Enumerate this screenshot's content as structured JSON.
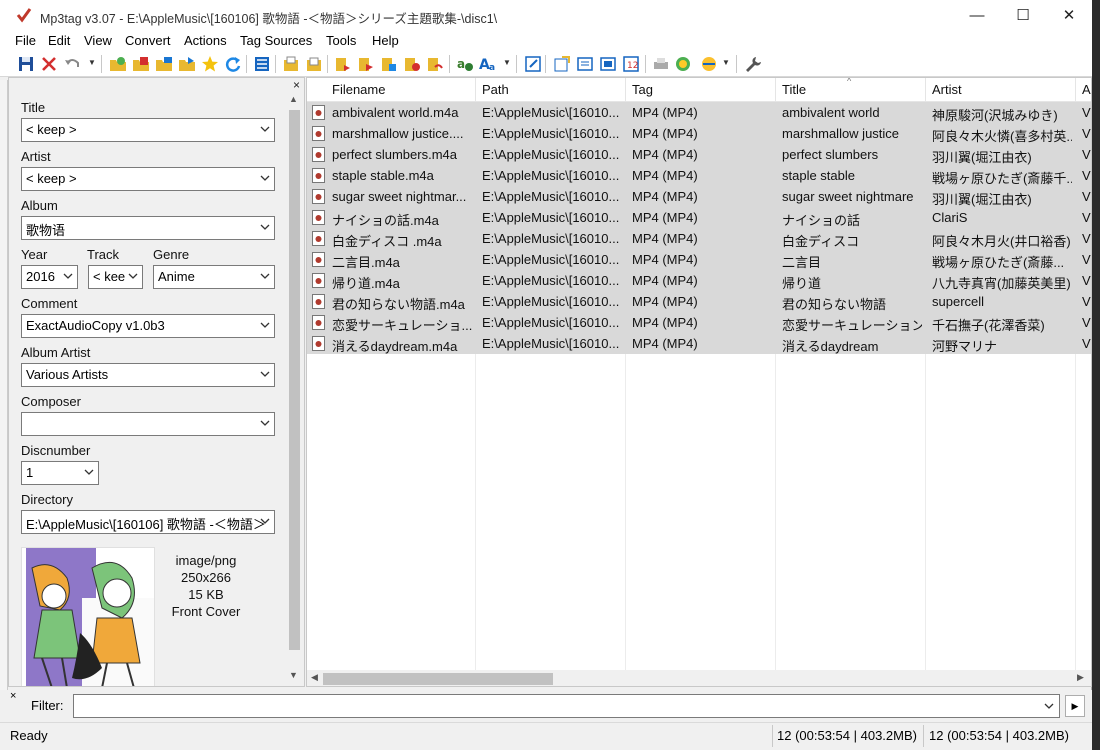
{
  "window": {
    "title": "Mp3tag v3.07  -  E:\\AppleMusic\\[160106] 歌物語 -＜物語＞シリーズ主題歌集-\\disc1\\",
    "minimize": "—",
    "maximize": "☐",
    "close": "✕"
  },
  "menu": [
    "File",
    "Edit",
    "View",
    "Convert",
    "Actions",
    "Tag Sources",
    "Tools",
    "Help"
  ],
  "tagpanel": {
    "close": "×",
    "title_label": "Title",
    "title_value": "< keep >",
    "artist_label": "Artist",
    "artist_value": "< keep >",
    "album_label": "Album",
    "album_value": "歌物语",
    "year_label": "Year",
    "year_value": "2016",
    "track_label": "Track",
    "track_value": "< kee",
    "genre_label": "Genre",
    "genre_value": "Anime",
    "comment_label": "Comment",
    "comment_value": "ExactAudioCopy v1.0b3",
    "albumartist_label": "Album Artist",
    "albumartist_value": "Various Artists",
    "composer_label": "Composer",
    "composer_value": "",
    "discnumber_label": "Discnumber",
    "discnumber_value": "1",
    "directory_label": "Directory",
    "directory_value": "E:\\AppleMusic\\[160106] 歌物語 -＜物語＞",
    "cover": {
      "mime": "image/png",
      "dimensions": "250x266",
      "size": "15 KB",
      "type": "Front Cover"
    }
  },
  "filelist": {
    "columns": [
      "Filename",
      "Path",
      "Tag",
      "Title",
      "Artist",
      "A"
    ],
    "rows": [
      {
        "filename": "ambivalent world.m4a",
        "path": "E:\\AppleMusic\\[16010...",
        "tag": "MP4 (MP4)",
        "title": "ambivalent world",
        "artist": "神原駿河(沢城みゆき)",
        "a": "V"
      },
      {
        "filename": "marshmallow justice....",
        "path": "E:\\AppleMusic\\[16010...",
        "tag": "MP4 (MP4)",
        "title": "marshmallow justice",
        "artist": "阿良々木火憐(喜多村英...",
        "a": "V"
      },
      {
        "filename": "perfect slumbers.m4a",
        "path": "E:\\AppleMusic\\[16010...",
        "tag": "MP4 (MP4)",
        "title": "perfect slumbers",
        "artist": " 羽川翼(堀江由衣)",
        "a": "V"
      },
      {
        "filename": "staple stable.m4a",
        "path": "E:\\AppleMusic\\[16010...",
        "tag": "MP4 (MP4)",
        "title": "staple stable",
        "artist": "戦場ヶ原ひたぎ(斎藤千...",
        "a": "V"
      },
      {
        "filename": "sugar sweet nightmar...",
        "path": "E:\\AppleMusic\\[16010...",
        "tag": "MP4 (MP4)",
        "title": "sugar sweet nightmare",
        "artist": " 羽川翼(堀江由衣)",
        "a": "V"
      },
      {
        "filename": "ナイショの話.m4a",
        "path": "E:\\AppleMusic\\[16010...",
        "tag": "MP4 (MP4)",
        "title": "ナイショの話",
        "artist": "ClariS",
        "a": "V"
      },
      {
        "filename": "白金ディスコ .m4a",
        "path": "E:\\AppleMusic\\[16010...",
        "tag": "MP4 (MP4)",
        "title": "白金ディスコ",
        "artist": "阿良々木月火(井口裕香)",
        "a": "V"
      },
      {
        "filename": "二言目.m4a",
        "path": "E:\\AppleMusic\\[16010...",
        "tag": "MP4 (MP4)",
        "title": "二言目",
        "artist": " 戦場ヶ原ひたぎ(斎藤...",
        "a": "V"
      },
      {
        "filename": "帰り道.m4a",
        "path": "E:\\AppleMusic\\[16010...",
        "tag": "MP4 (MP4)",
        "title": "帰り道",
        "artist": " 八九寺真宵(加藤英美里)",
        "a": "V"
      },
      {
        "filename": "君の知らない物語.m4a",
        "path": "E:\\AppleMusic\\[16010...",
        "tag": "MP4 (MP4)",
        "title": "君の知らない物語",
        "artist": " supercell",
        "a": "V"
      },
      {
        "filename": "恋愛サーキュレーショ...",
        "path": "E:\\AppleMusic\\[16010...",
        "tag": "MP4 (MP4)",
        "title": "恋愛サーキュレーション",
        "artist": "千石撫子(花澤香菜)",
        "a": "V"
      },
      {
        "filename": "消えるdaydream.m4a",
        "path": "E:\\AppleMusic\\[16010...",
        "tag": "MP4 (MP4)",
        "title": "消えるdaydream",
        "artist": "河野マリナ",
        "a": "V"
      }
    ]
  },
  "filter": {
    "close": "×",
    "label": "Filter:",
    "value": "",
    "go": "▶"
  },
  "status": {
    "left": "Ready",
    "selected": "12 (00:53:54 | 403.2MB)",
    "total": "12 (00:53:54 | 403.2MB)"
  },
  "colors": {
    "selected_row": "#d9d9d9",
    "window_bg": "#f0f0f0",
    "accent_red": "#c0392b"
  }
}
